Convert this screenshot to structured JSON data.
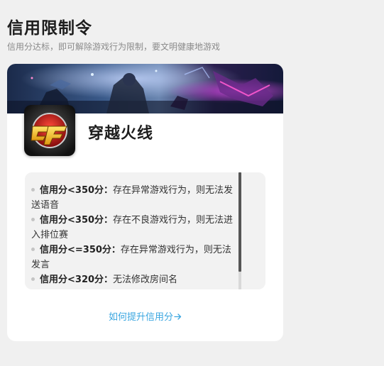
{
  "header": {
    "title": "信用限制令",
    "subtitle": "信用分达标，即可解除游戏行为限制，要文明健康地游戏"
  },
  "game": {
    "name": "穿越火线",
    "logo_text": "CF"
  },
  "rules": [
    {
      "key": "信用分<350分：",
      "text": "存在异常游戏行为，则无法发送语音"
    },
    {
      "key": "信用分<350分：",
      "text": "存在不良游戏行为，则无法进入排位赛"
    },
    {
      "key": "信用分<=350分：",
      "text": "存在异常游戏行为，则无法发言"
    },
    {
      "key": "信用分<320分：",
      "text": "无法修改房间名"
    }
  ],
  "footer": {
    "improve_link": "如何提升信用分",
    "arrow_icon": "arrow-right-icon"
  },
  "colors": {
    "background": "#f0f0f0",
    "card": "#ffffff",
    "link": "#3aa6e0",
    "rules_box": "#f2f2f2"
  }
}
